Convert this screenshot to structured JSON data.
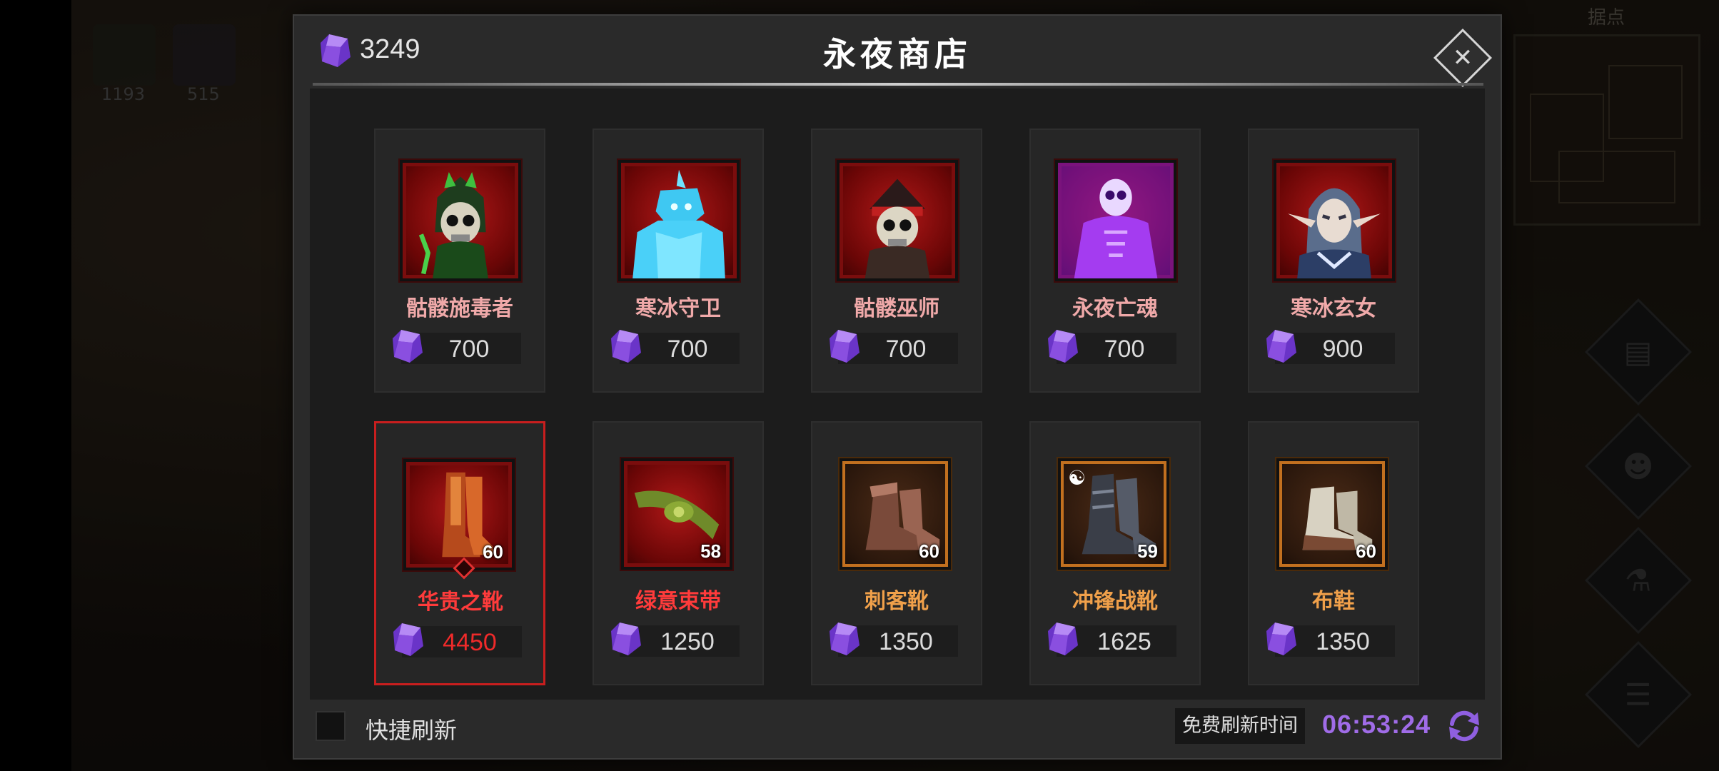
{
  "background": {
    "resources": [
      {
        "icon": "green-feather-icon",
        "count": "1193"
      },
      {
        "icon": "purple-feather-icon",
        "count": "515"
      }
    ],
    "minimap_title": "据点",
    "side_buttons": [
      "scroll-icon",
      "group-icon",
      "potion-icon",
      "list-icon"
    ]
  },
  "shop": {
    "title": "永夜商店",
    "gem_total": "3249",
    "quick_refresh_label": "快捷刷新",
    "free_refresh_label": "免费刷新时间",
    "timer": "06:53:24"
  },
  "colors": {
    "gem": "#8a4fe0",
    "selected_border": "#c81e1e",
    "hero_name": "#f0a9a9",
    "red_item": "#ff3b3b",
    "orange_item": "#f0a04a",
    "timer": "#a06ce8"
  },
  "heroes": [
    {
      "name": "骷髅施毒者",
      "price": "700",
      "art": "skeleton-poisoner"
    },
    {
      "name": "寒冰守卫",
      "price": "700",
      "art": "ice-guardian"
    },
    {
      "name": "骷髅巫师",
      "price": "700",
      "art": "skeleton-wizard"
    },
    {
      "name": "永夜亡魂",
      "price": "700",
      "art": "eternal-wraith"
    },
    {
      "name": "寒冰玄女",
      "price": "900",
      "art": "ice-maiden"
    }
  ],
  "items": [
    {
      "name": "华贵之靴",
      "price": "4450",
      "level": "60",
      "rarity": "red",
      "selected": true,
      "art": "noble-boots"
    },
    {
      "name": "绿意束带",
      "price": "1250",
      "level": "58",
      "rarity": "red",
      "selected": false,
      "art": "green-belt"
    },
    {
      "name": "刺客靴",
      "price": "1350",
      "level": "60",
      "rarity": "orange",
      "selected": false,
      "art": "assassin-boots"
    },
    {
      "name": "冲锋战靴",
      "price": "1625",
      "level": "59",
      "rarity": "orange",
      "selected": false,
      "art": "charge-boots"
    },
    {
      "name": "布鞋",
      "price": "1350",
      "level": "60",
      "rarity": "orange",
      "selected": false,
      "art": "cloth-shoes"
    }
  ]
}
